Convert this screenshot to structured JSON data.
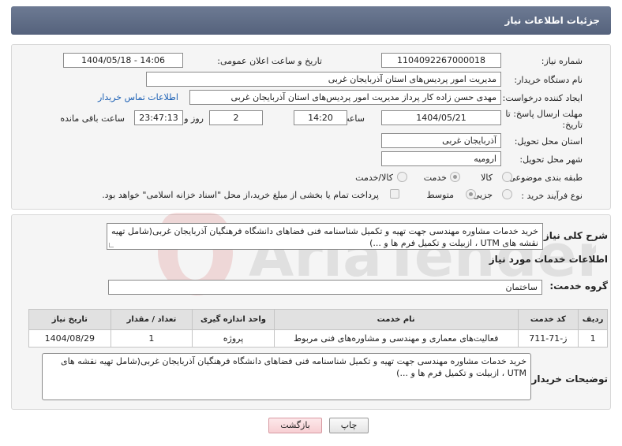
{
  "header": {
    "title": "جزئیات اطلاعات نیاز"
  },
  "form": {
    "need_number_label": "شماره نیاز:",
    "need_number": "1104092267000018",
    "announce_label": "تاریخ و ساعت اعلان عمومی:",
    "announce_value": "1404/05/18 - 14:06",
    "buyer_org_label": "نام دستگاه خریدار:",
    "buyer_org": "مدیریت امور پردیس‌های استان آذربایجان غربی",
    "creator_label": "ایجاد کننده درخواست:",
    "creator": "مهدی حسن زاده کار پرداز مدیریت امور پردیس‌های استان آذربایجان غربی",
    "contact_link": "اطلاعات تماس خریدار",
    "deadline_label_1": "مهلت ارسال پاسخ: تا",
    "deadline_label_2": "تاریخ:",
    "deadline_date": "1404/05/21",
    "time_label": "ساعت",
    "deadline_time": "14:20",
    "days_value": "2",
    "days_label": "روز و",
    "remaining_value": "23:47:13",
    "remaining_label": "ساعت باقی مانده",
    "province_label": "استان محل تحویل:",
    "province": "آذربایجان غربی",
    "city_label": "شهر محل تحویل:",
    "city": "ارومیه",
    "category_label": "طبقه بندی موضوعی:",
    "category_options": [
      "کالا",
      "خدمت",
      "کالا/خدمت"
    ],
    "purchase_type_label": "نوع فرآیند خرید :",
    "purchase_type_options": [
      "جزیی",
      "متوسط"
    ],
    "payment_note": "پرداخت تمام یا بخشی از مبلغ خرید،از محل \"اسناد خزانه اسلامی\" خواهد بود."
  },
  "details": {
    "summary_label": "شرح کلی نیاز:",
    "summary": "خرید خدمات مشاوره مهندسی جهت تهیه و تکمیل شناسنامه فنی فضاهای دانشگاه فرهنگیان آذربایجان غربی(شامل تهیه نقشه های UTM ، ازبیلت و تکمیل فرم ها و ...)",
    "services_title": "اطلاعات خدمات مورد نیاز",
    "service_group_label": "گروه خدمت:",
    "service_group": "ساختمان",
    "table": {
      "headers": [
        "ردیف",
        "کد خدمت",
        "نام خدمت",
        "واحد اندازه گیری",
        "تعداد / مقدار",
        "تاریخ نیاز"
      ],
      "rows": [
        [
          "1",
          "ز-71-711",
          "فعالیت‌های معماری و مهندسی و مشاوره‌های فنی مربوط",
          "پروژه",
          "1",
          "1404/08/29"
        ]
      ]
    },
    "buyer_notes_label": "توضیحات خریدار:",
    "buyer_notes": "خرید خدمات مشاوره مهندسی جهت تهیه و تکمیل شناسنامه فنی فضاهای دانشگاه فرهنگیان آذربایجان غربی(شامل تهیه نقشه های UTM ، ازبیلت و تکمیل فرم ها و ...)"
  },
  "buttons": {
    "print": "چاپ",
    "back": "بازگشت"
  },
  "watermark": {
    "text": "AriaTender.net"
  }
}
